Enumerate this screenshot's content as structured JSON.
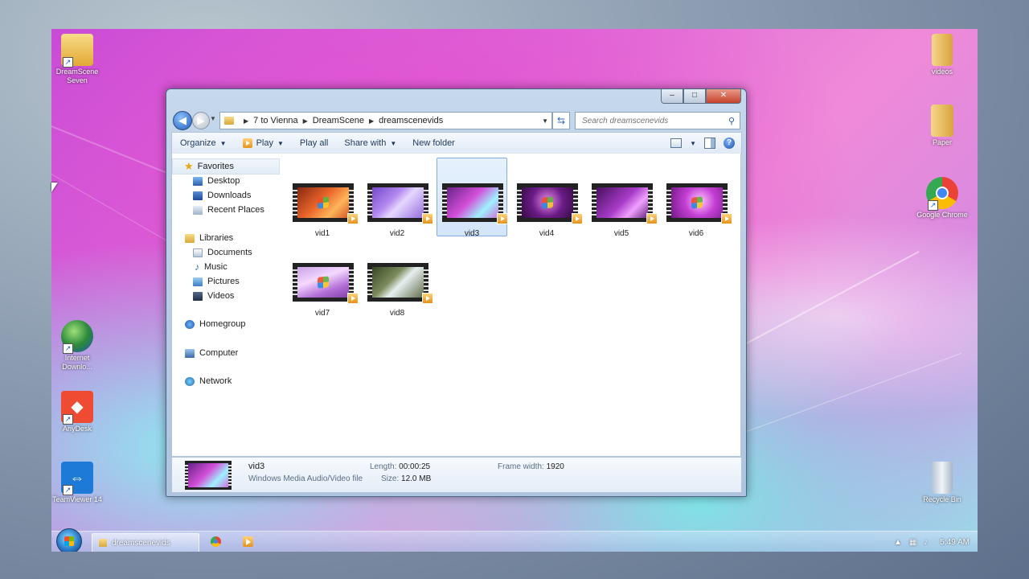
{
  "desktop": {
    "icons_left": [
      {
        "label": "DreamScene Seven",
        "color": "#f0c05a"
      },
      {
        "label": "Internet Downlo...",
        "color": "#3a8fd6"
      },
      {
        "label": "AnyDesk",
        "color": "#ef4b32"
      },
      {
        "label": "TeamViewer 14",
        "color": "#1d7ad6"
      }
    ],
    "icons_right": [
      {
        "label": "videos",
        "color": "#f1cf72"
      },
      {
        "label": "Paper",
        "color": "#f1cf72"
      },
      {
        "label": "Google Chrome",
        "color": "#4285f4"
      },
      {
        "label": "Recycle Bin",
        "color": "#cfd8e3"
      }
    ]
  },
  "window": {
    "controls": {
      "minimize": "–",
      "maximize": "□",
      "close": "✕"
    },
    "nav": {
      "back": "◀",
      "forward": "▶"
    },
    "breadcrumb": [
      "7 to Vienna",
      "DreamScene",
      "dreamscenevids"
    ],
    "search_placeholder": "Search dreamscenevids",
    "toolbar": {
      "organize": "Organize",
      "play": "Play",
      "play_all": "Play all",
      "share_with": "Share with",
      "new_folder": "New folder",
      "help": "?"
    },
    "nav_pane": {
      "favorites": "Favorites",
      "desktop": "Desktop",
      "downloads": "Downloads",
      "recent_places": "Recent Places",
      "libraries": "Libraries",
      "documents": "Documents",
      "music": "Music",
      "pictures": "Pictures",
      "videos": "Videos",
      "homegroup": "Homegroup",
      "computer": "Computer",
      "network": "Network"
    },
    "files": [
      {
        "name": "vid1",
        "grad": "linear-gradient(135deg,#7a1f0e,#e9652a 45%,#ffb55a 70%,#c8421c)"
      },
      {
        "name": "vid2",
        "grad": "linear-gradient(135deg,#6a3dc4,#b58af0 40%,#e5d8ff 55%,#8a5ed8)"
      },
      {
        "name": "vid3",
        "grad": "linear-gradient(135deg,#5a1d7d,#d34fd8 45%,#9ff1ff 70%,#d45bd2)",
        "selected": true
      },
      {
        "name": "vid4",
        "grad": "radial-gradient(circle at 50% 45%,#e58ae8 0%,#6b1b86 45%,#25082f 100%)"
      },
      {
        "name": "vid5",
        "grad": "linear-gradient(135deg,#3b0b52,#a83bc7 50%,#f0a0ff 70%,#4b0f63)"
      },
      {
        "name": "vid6",
        "grad": "radial-gradient(circle at 55% 45%,#ffc7ff 0%,#c43fd4 40%,#5e0f72 100%)"
      },
      {
        "name": "vid7",
        "grad": "linear-gradient(160deg,#c59de6,#f4d9ff 40%,#b36fd6 70%,#7d3da4)"
      },
      {
        "name": "vid8",
        "grad": "linear-gradient(135deg,#2b3b1d,#7d8c5c 40%,#e8f0f0 55%,#4d5a34)"
      }
    ],
    "details": {
      "name": "vid3",
      "type": "Windows Media Audio/Video file",
      "length_label": "Length:",
      "length_value": "00:00:25",
      "size_label": "Size:",
      "size_value": "12.0 MB",
      "frame_label": "Frame width:",
      "frame_value": "1920"
    }
  },
  "taskbar": {
    "explorer_label": "dreamscenevids",
    "clock": "5:49 AM"
  }
}
